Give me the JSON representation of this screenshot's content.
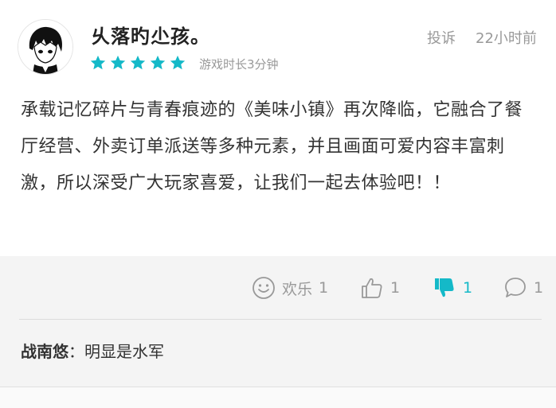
{
  "review": {
    "username": "乆落旳尐孩。",
    "report_label": "投诉",
    "time_ago": "22小时前",
    "rating": 5,
    "playtime": "游戏时长3分钟",
    "content": "承载记忆碎片与青春痕迹的《美味小镇》再次降临，它融合了餐厅经营、外卖订单派送等多种元素，并且画面可爱内容丰富刺激，所以深受广大玩家喜爱，让我们一起去体验吧！！"
  },
  "actions": {
    "happy_label": "欢乐",
    "happy_count": "1",
    "like_count": "1",
    "dislike_count": "1",
    "comment_count": "1"
  },
  "reply": {
    "name": "战南悠",
    "separator": "：",
    "text": "明显是水军"
  },
  "colors": {
    "star": "#14b9c8",
    "dislike_active": "#14b9c8",
    "muted": "#999999"
  },
  "icons": [
    "avatar",
    "star-icon",
    "smiley-icon",
    "thumbs-up-icon",
    "thumbs-down-icon",
    "comment-icon"
  ]
}
